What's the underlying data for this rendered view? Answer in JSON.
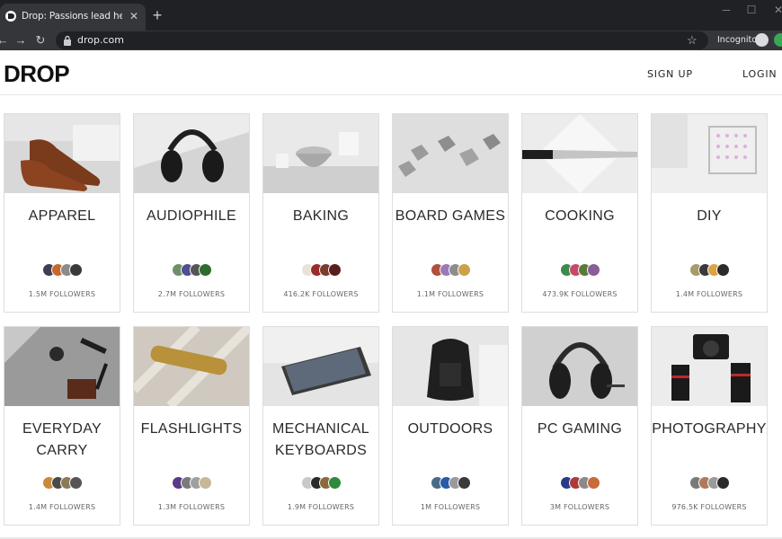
{
  "browser": {
    "tab_title": "Drop: Passions lead here (formerly Massdrop)",
    "tab_close": "✕",
    "new_tab": "+",
    "url": "drop.com",
    "incognito_label": "Incognito",
    "window_minimize": "─",
    "window_maximize": "☐",
    "window_close": "✕",
    "back": "←",
    "forward": "→",
    "reload": "↻",
    "bookmark": "☆"
  },
  "header": {
    "logo": "DROP",
    "sign_up": "SIGN UP",
    "login": "LOGIN"
  },
  "categories": [
    {
      "title_lines": [
        "APPAREL",
        ""
      ],
      "followers": "1.5M FOLLOWERS",
      "avatar_colors": [
        "#3b3f57",
        "#c66a2c",
        "#8b8b8b",
        "#3a3a3a"
      ]
    },
    {
      "title_lines": [
        "AUDIOPHILE",
        ""
      ],
      "followers": "2.7M FOLLOWERS",
      "avatar_colors": [
        "#6f8f6a",
        "#4f4f8f",
        "#555555",
        "#2e6b2e"
      ]
    },
    {
      "title_lines": [
        "BAKING",
        ""
      ],
      "followers": "416.2K FOLLOWERS",
      "avatar_colors": [
        "#e9e2d8",
        "#9a2c2c",
        "#7b3c2a",
        "#5a1d1d"
      ]
    },
    {
      "title_lines": [
        "BOARD GAMES",
        ""
      ],
      "followers": "1.1M FOLLOWERS",
      "avatar_colors": [
        "#b0503a",
        "#9a7bb7",
        "#8d8d8d",
        "#cba24b"
      ]
    },
    {
      "title_lines": [
        "COOKING",
        ""
      ],
      "followers": "473.9K FOLLOWERS",
      "avatar_colors": [
        "#3b8b4b",
        "#c54a6a",
        "#5a7a3a",
        "#8a5c9a"
      ]
    },
    {
      "title_lines": [
        "DIY",
        ""
      ],
      "followers": "1.4M FOLLOWERS",
      "avatar_colors": [
        "#a89a6a",
        "#3a3a3a",
        "#d9a441",
        "#2b2b2b"
      ]
    },
    {
      "title_lines": [
        "EVERYDAY CARRY",
        ""
      ],
      "followers": "1.4M FOLLOWERS",
      "avatar_colors": [
        "#c98a3a",
        "#4a4a4a",
        "#8a7a5a",
        "#555555"
      ]
    },
    {
      "title_lines": [
        "FLASHLIGHTS",
        ""
      ],
      "followers": "1.3M FOLLOWERS",
      "avatar_colors": [
        "#5a3a8a",
        "#7a7a7a",
        "#a0a0a0",
        "#c8b898"
      ]
    },
    {
      "title_lines": [
        "MECHANICAL",
        "KEYBOARDS"
      ],
      "followers": "1.9M FOLLOWERS",
      "avatar_colors": [
        "#c8c8c8",
        "#2b2b2b",
        "#8a6a3a",
        "#2e8b3e"
      ]
    },
    {
      "title_lines": [
        "OUTDOORS",
        ""
      ],
      "followers": "1M FOLLOWERS",
      "avatar_colors": [
        "#4a6a8a",
        "#2a5aa8",
        "#9a9a9a",
        "#3a3a3a"
      ]
    },
    {
      "title_lines": [
        "PC GAMING",
        ""
      ],
      "followers": "3M FOLLOWERS",
      "avatar_colors": [
        "#2a3a8a",
        "#b03a3a",
        "#8a8a8a",
        "#c86a3a"
      ]
    },
    {
      "title_lines": [
        "PHOTOGRAPHY",
        ""
      ],
      "followers": "976.5K FOLLOWERS",
      "avatar_colors": [
        "#7a7a7a",
        "#b07a5a",
        "#9a9a9a",
        "#2b2b2b"
      ]
    }
  ]
}
